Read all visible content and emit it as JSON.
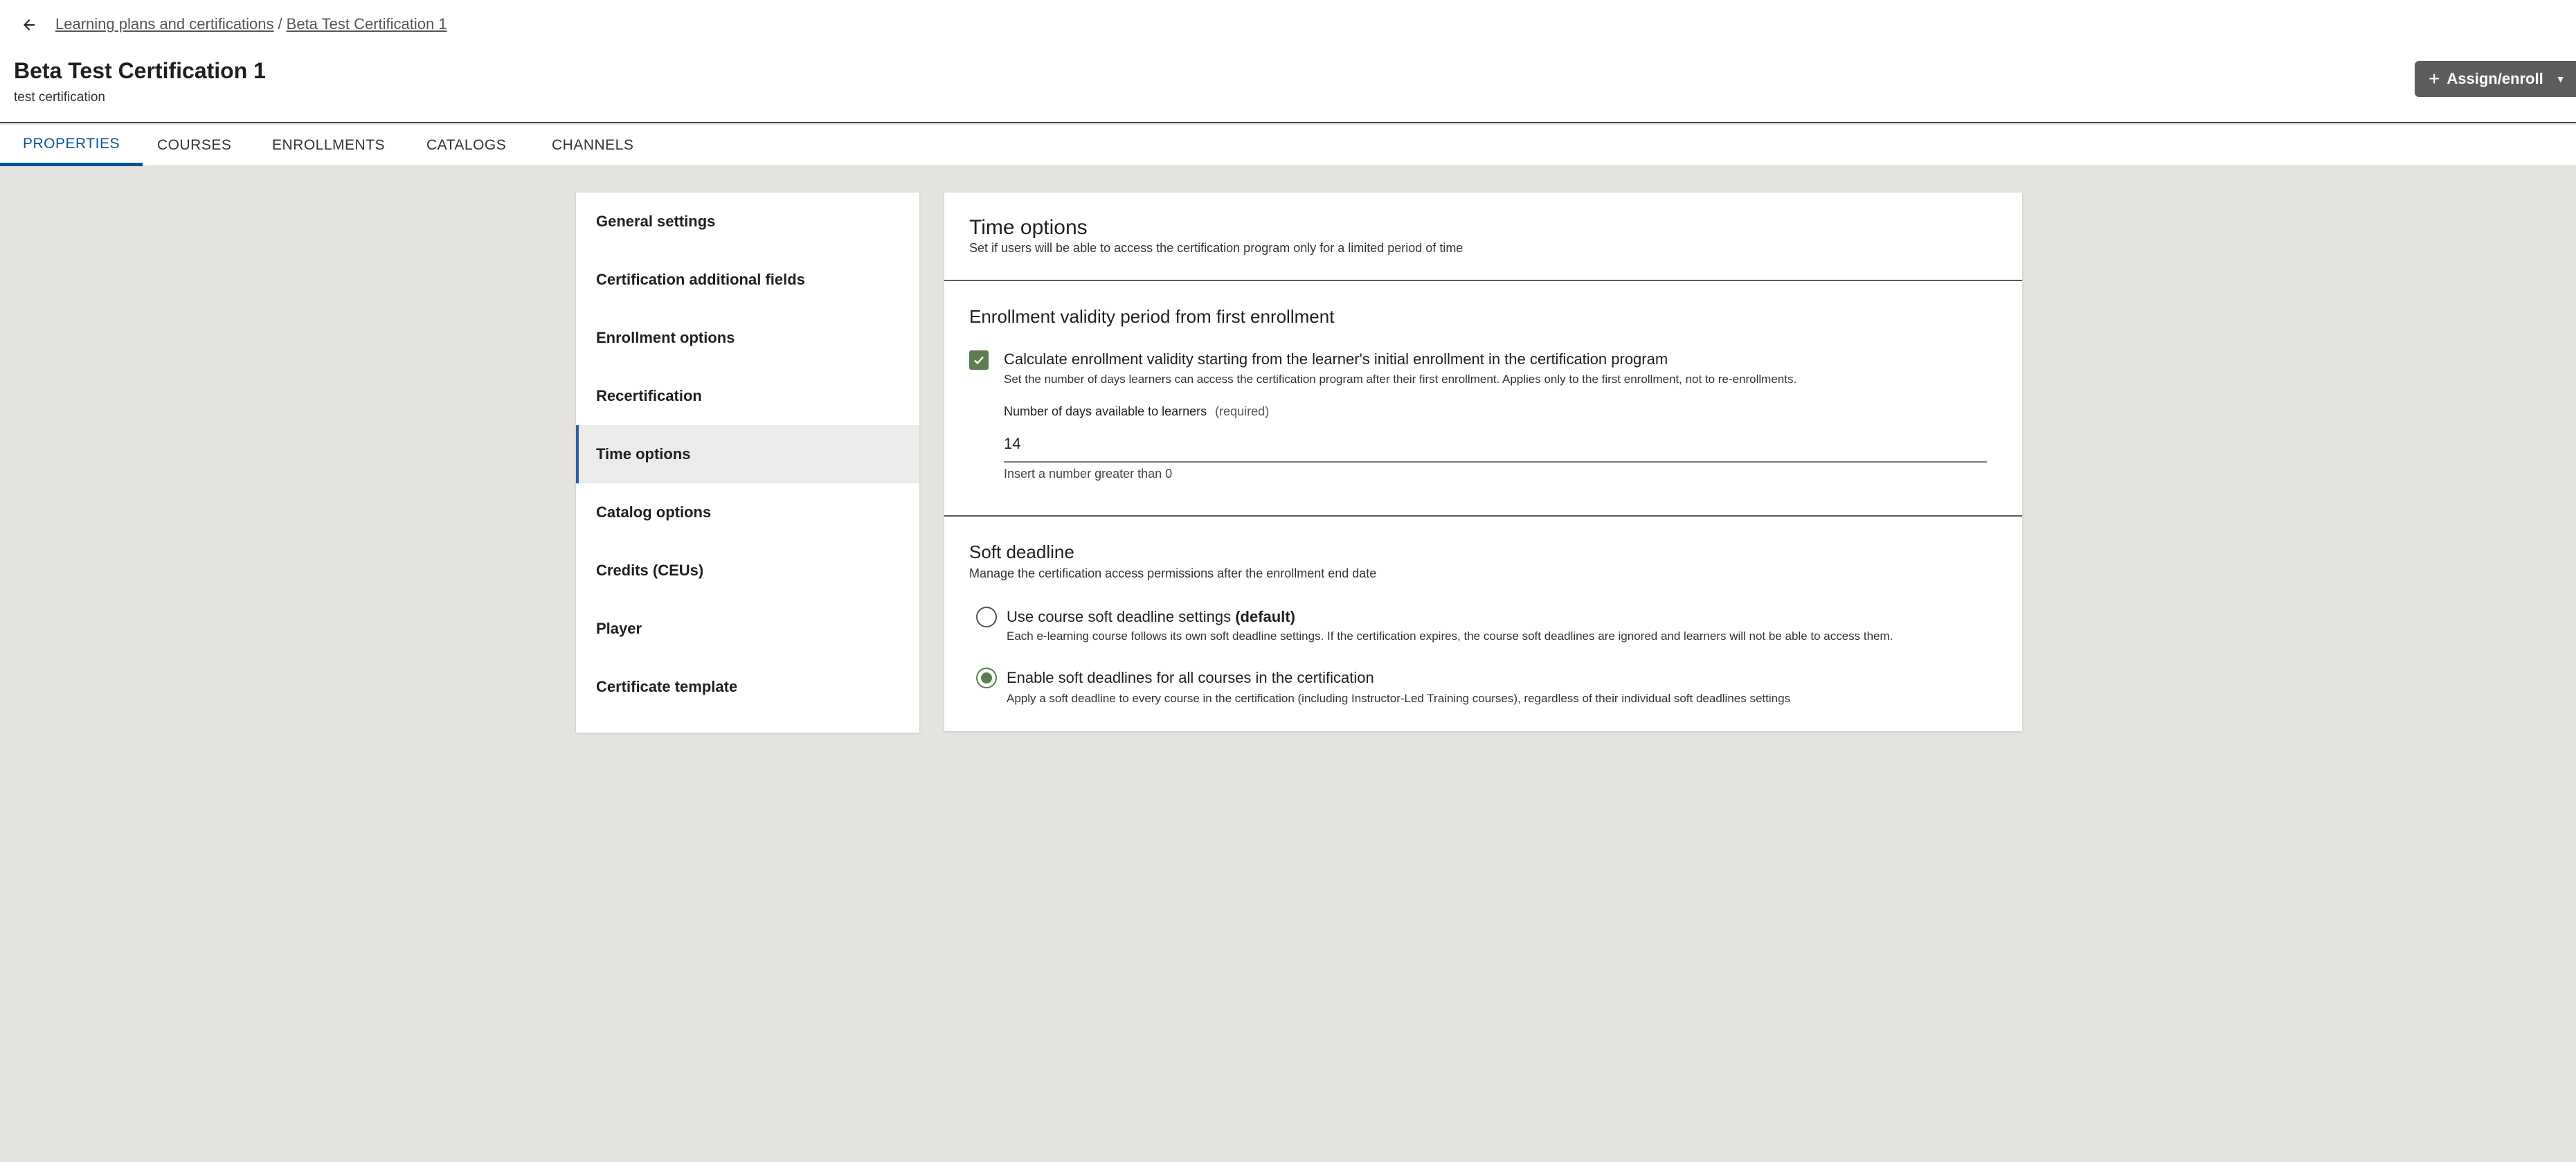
{
  "breadcrumb": {
    "parent": "Learning plans and certifications",
    "separator": "/",
    "current": "Beta Test Certification 1"
  },
  "header": {
    "title": "Beta Test Certification 1",
    "subtitle": "test certification",
    "assign_button": "Assign/enroll",
    "back_icon": "arrow-left-icon"
  },
  "tabs": [
    {
      "label": "PROPERTIES",
      "active": true
    },
    {
      "label": "COURSES",
      "active": false
    },
    {
      "label": "ENROLLMENTS",
      "active": false
    },
    {
      "label": "CATALOGS",
      "active": false
    },
    {
      "label": "CHANNELS",
      "active": false
    }
  ],
  "nav": {
    "items": [
      {
        "label": "General settings"
      },
      {
        "label": "Certification additional fields"
      },
      {
        "label": "Enrollment options"
      },
      {
        "label": "Recertification"
      },
      {
        "label": "Time options",
        "active": true
      },
      {
        "label": "Catalog options"
      },
      {
        "label": "Credits (CEUs)"
      },
      {
        "label": "Player"
      },
      {
        "label": "Certificate template"
      }
    ]
  },
  "panel": {
    "title": "Time options",
    "subtitle": "Set if users will be able to access the certification program only for a limited period of time",
    "validity": {
      "heading": "Enrollment validity period from first enrollment",
      "checkbox_label": "Calculate enrollment validity starting from the learner's initial enrollment in the certification program",
      "checkbox_desc": "Set the number of days learners can access the certification program after their first enrollment. Applies only to the first enrollment, not to re-enrollments.",
      "checked": true,
      "field_label": "Number of days available to learners",
      "field_required": "(required)",
      "field_value": "14",
      "field_hint": "Insert a number greater than 0"
    },
    "soft_deadline": {
      "heading": "Soft deadline",
      "subtitle": "Manage the certification access permissions after the enrollment end date",
      "option1_label": "Use course soft deadline settings",
      "option1_suffix": "(default)",
      "option1_desc": "Each e-learning course follows its own soft deadline settings. If the certification expires, the course soft deadlines are ignored and learners will not be able to access them.",
      "option2_label": "Enable soft deadlines for all courses in the certification",
      "option2_desc": "Apply a soft deadline to every course in the certification (including Instructor-Led Training courses), regardless of their individual soft deadlines settings",
      "selected": 2
    }
  },
  "colors": {
    "accent": "#0b5394",
    "check_green": "#5b7d4f",
    "button_gray": "#5d5d5d",
    "background": "#e5e4e0"
  }
}
